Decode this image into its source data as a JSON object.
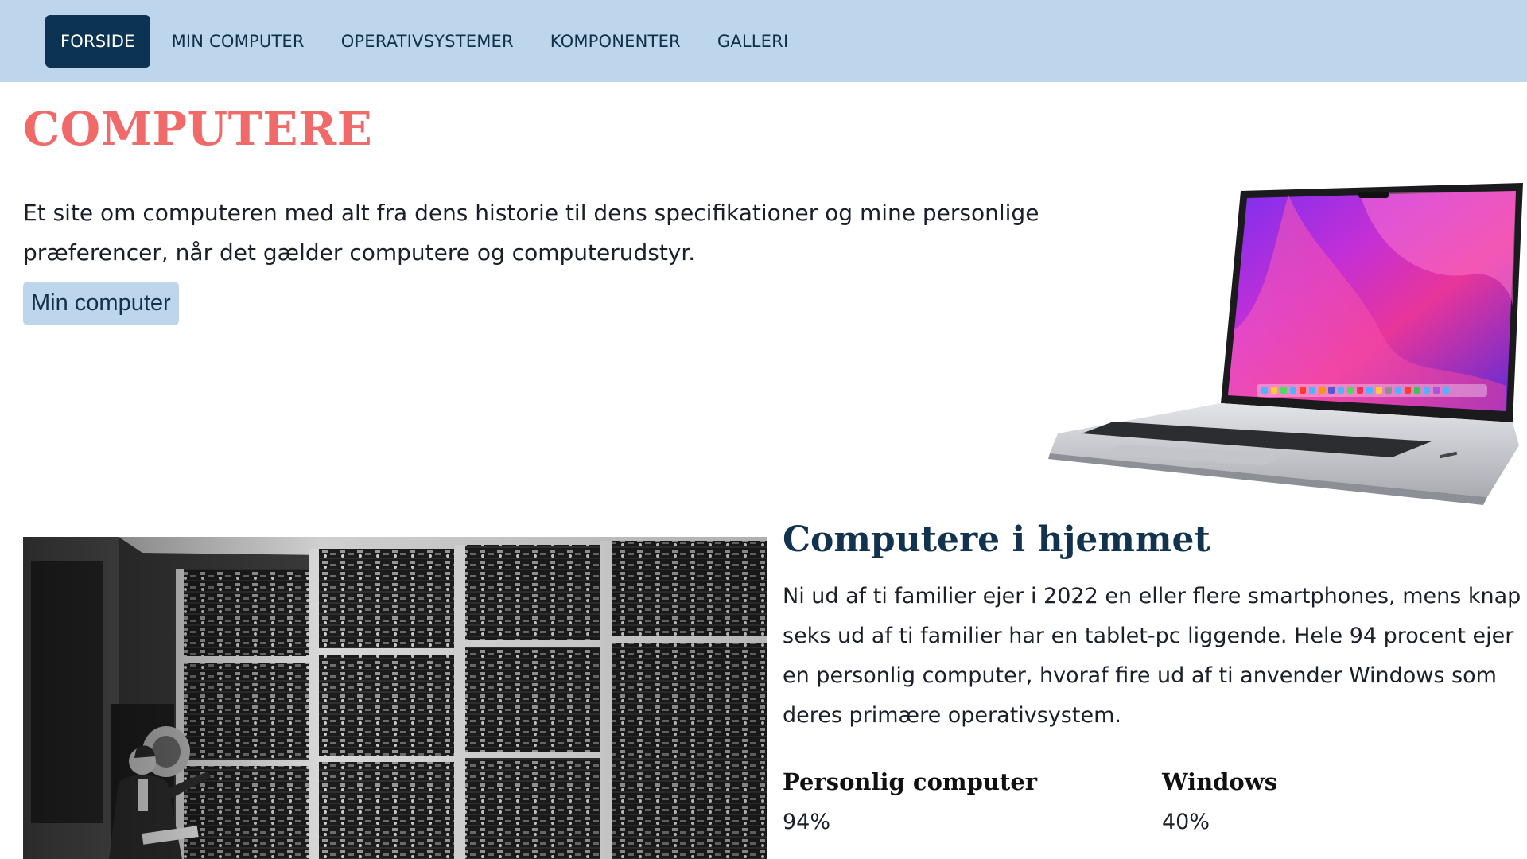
{
  "nav": {
    "items": [
      {
        "label": "FORSIDE",
        "active": true
      },
      {
        "label": "MIN COMPUTER",
        "active": false
      },
      {
        "label": "OPERATIVSYSTEMER",
        "active": false
      },
      {
        "label": "KOMPONENTER",
        "active": false
      },
      {
        "label": "GALLERI",
        "active": false
      }
    ]
  },
  "hero": {
    "title": "COMPUTERE",
    "intro": "Et site om computeren med alt fra dens historie til dens specifikationer og mine personlige præferencer, når det gælder computere og computerudstyr.",
    "button_label": "Min computer"
  },
  "home_section": {
    "heading": "Computere i hjemmet",
    "text": "Ni ud af ti familier ejer i 2022 en eller flere smartphones, mens knap seks ud af ti familier har en tablet-pc liggende. Hele 94 procent ejer en personlig computer, hvoraf fire ud af ti anvender Windows som deres primære operativsystem.",
    "stats": [
      {
        "label": "Personlig computer",
        "value": "94%"
      },
      {
        "label": "Windows",
        "value": "40%"
      }
    ]
  },
  "colors": {
    "nav_bg": "#bdd6eb",
    "nav_active": "#0c3352",
    "title": "#f06a6a",
    "heading": "#12334f"
  }
}
